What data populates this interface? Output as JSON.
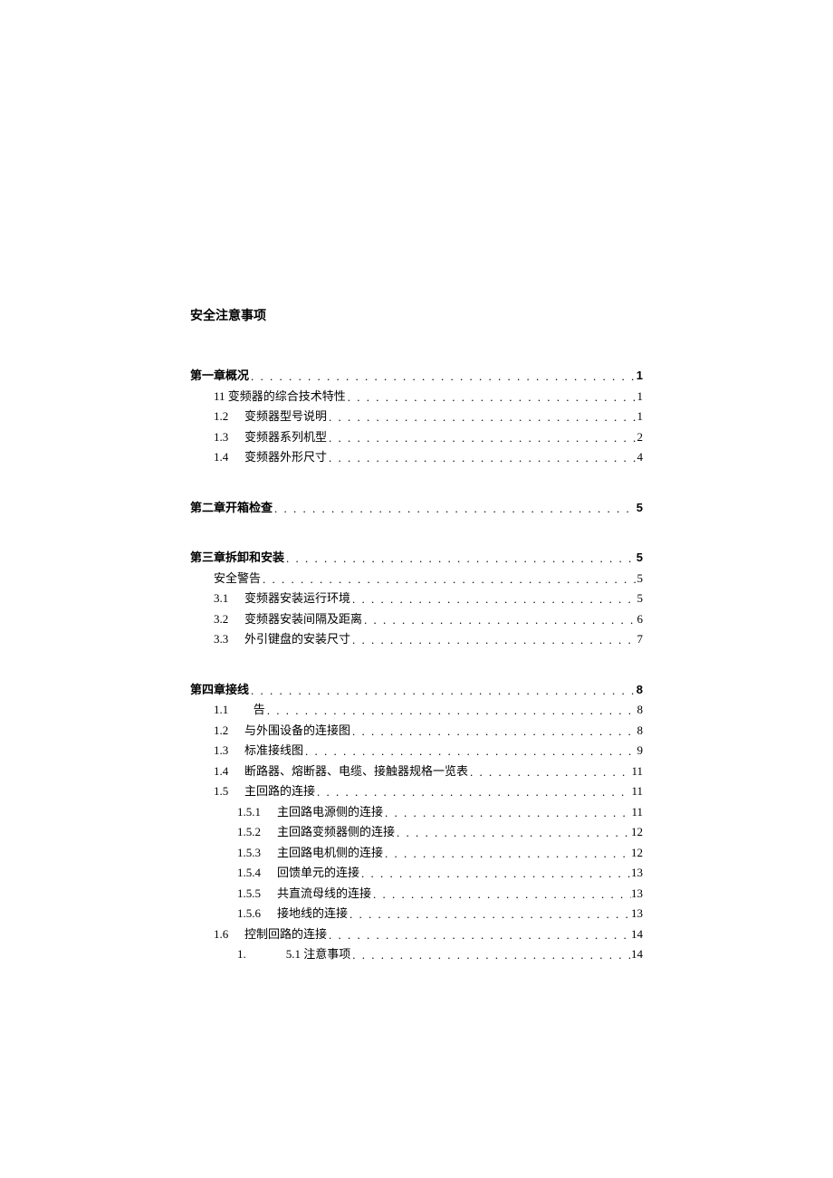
{
  "safety_title": "安全注意事项",
  "chapters": [
    {
      "title": "第一章概况",
      "page": "1",
      "entries": [
        {
          "num": "",
          "text": "11 变频器的综合技术特性",
          "page": "1",
          "indent": 1
        },
        {
          "num": "1.2",
          "text": "变频器型号说明",
          "page": "1",
          "indent": 1
        },
        {
          "num": "1.3",
          "text": "变频器系列机型",
          "page": "2",
          "indent": 1
        },
        {
          "num": "1.4",
          "text": "变频器外形尺寸",
          "page": "4",
          "indent": 1
        }
      ]
    },
    {
      "title": "第二章开箱检查",
      "page": "5",
      "entries": []
    },
    {
      "title": "第三章拆卸和安装",
      "page": "5",
      "entries": [
        {
          "num": "",
          "text": "安全警告",
          "page": "5",
          "indent": 1
        },
        {
          "num": "3.1",
          "text": "变频器安装运行环境",
          "page": "5",
          "indent": 1
        },
        {
          "num": "3.2",
          "text": "变频器安装间隔及距离",
          "page": "6",
          "indent": 1
        },
        {
          "num": "3.3",
          "text": "外引键盘的安装尺寸",
          "page": "7",
          "indent": 1
        }
      ]
    },
    {
      "title": "第四章接线",
      "page": "8",
      "entries": [
        {
          "num": "1.1",
          "text": "告",
          "page": "8",
          "indent": 1,
          "gap": true
        },
        {
          "num": "1.2",
          "text": "与外围设备的连接图",
          "page": "8",
          "indent": 1
        },
        {
          "num": "1.3",
          "text": "标准接线图",
          "page": "9",
          "indent": 1
        },
        {
          "num": "1.4",
          "text": "断路器、熔断器、电缆、接触器规格一览表",
          "page": "11",
          "indent": 1
        },
        {
          "num": "1.5",
          "text": "主回路的连接",
          "page": "11",
          "indent": 1
        },
        {
          "num": "1.5.1",
          "text": "主回路电源侧的连接",
          "page": "11",
          "indent": 2
        },
        {
          "num": "1.5.2",
          "text": "主回路变频器侧的连接",
          "page": "12",
          "indent": 2
        },
        {
          "num": "1.5.3",
          "text": "主回路电机侧的连接",
          "page": "12",
          "indent": 2
        },
        {
          "num": "1.5.4",
          "text": "回馈单元的连接",
          "page": "13",
          "indent": 2
        },
        {
          "num": "1.5.5",
          "text": "共直流母线的连接",
          "page": "13",
          "indent": 2
        },
        {
          "num": "1.5.6",
          "text": "接地线的连接",
          "page": "13",
          "indent": 2
        },
        {
          "num": "1.6",
          "text": "控制回路的连接",
          "page": "14",
          "indent": 1
        },
        {
          "num": "1.",
          "text": "5.1 注意事项",
          "page": "14",
          "indent": 2,
          "gap": true
        }
      ]
    }
  ]
}
